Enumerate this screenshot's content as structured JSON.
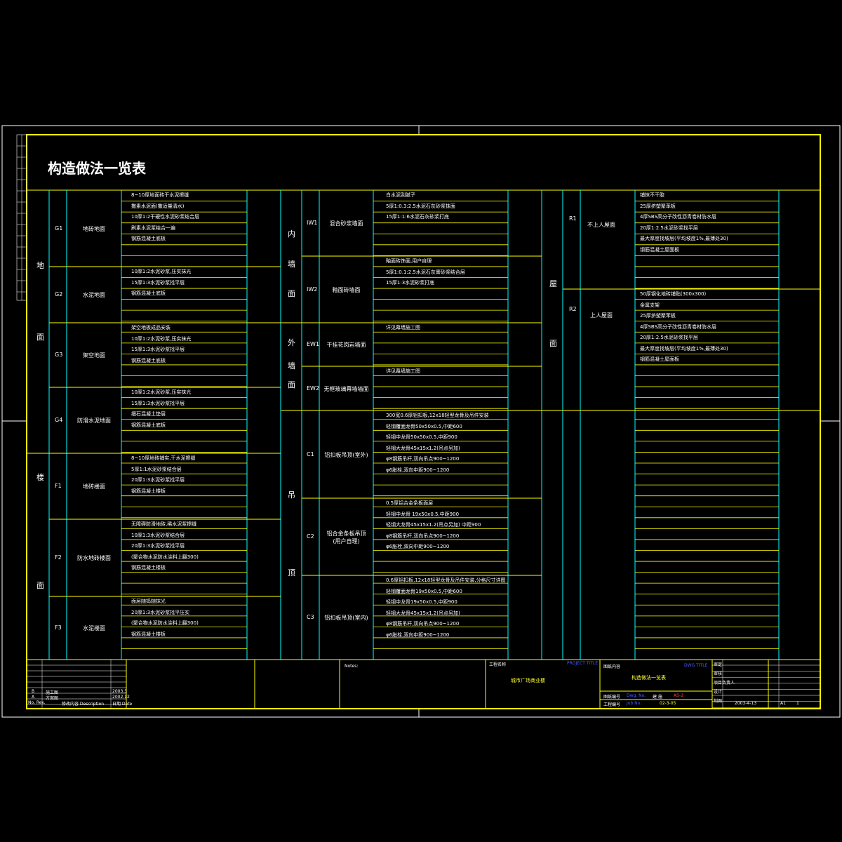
{
  "title": "构造做法一览表",
  "colors": {
    "frame": "#ffff00",
    "grid": "#00ffff",
    "row": "#ffff00",
    "text": "#ffffff",
    "blue": "#4a5cff"
  },
  "col1": {
    "cat_floor": [
      "地",
      "面"
    ],
    "cat_lou": [
      "楼",
      "面"
    ],
    "items": [
      {
        "code": "G1",
        "name": "地砖地面",
        "lines": [
          "8~10厚地面砖干水泥擦缝",
          "撒素水泥面(撒适量清水)",
          "10厚1:2干硬性水泥砂浆结合层",
          "刷素水泥浆结合一遍",
          "钢筋混凝土底板"
        ]
      },
      {
        "code": "G2",
        "name": "水泥地面",
        "lines": [
          "10厚1:2水泥砂浆,压实抹光",
          "15厚1:3水泥砂浆找平层",
          "钢筋混凝土底板"
        ]
      },
      {
        "code": "G3",
        "name": "架空地面",
        "lines": [
          "架空地板成品安装",
          "10厚1:2水泥砂浆,压实抹光",
          "15厚1:3水泥砂浆找平层",
          "钢筋混凝土底板"
        ]
      },
      {
        "code": "G4",
        "name": "防滑水泥地面",
        "lines": [
          "10厚1:2水泥砂浆,压实抹光",
          "15厚1:3水泥砂浆找平层",
          "细石混凝土垫层",
          "钢筋混凝土底板"
        ]
      },
      {
        "code": "F1",
        "name": "地砖楼面",
        "lines": [
          "8~10厚地砖铺实,干水泥擦缝",
          "5厚1:1水泥砂浆结合层",
          "20厚1:3水泥砂浆找平层",
          "钢筋混凝土楼板"
        ]
      },
      {
        "code": "F2",
        "name": "防水地砖楼面",
        "lines": [
          "无障碍防滑地砖,稀水泥浆擦缝",
          "10厚1:3水泥砂浆结合层",
          "20厚1:3水泥砂浆找平层",
          "(聚合物水泥防水涂料上翻300)",
          "钢筋混凝土楼板"
        ]
      },
      {
        "code": "F3",
        "name": "水泥楼面",
        "lines": [
          "面层随捣随抹光",
          "20厚1:3水泥砂浆找平压实",
          "(聚合物水泥防水涂料上翻300)",
          "钢筋混凝土楼板"
        ]
      }
    ]
  },
  "col2": {
    "cat_inner": [
      "内",
      "墙",
      "面"
    ],
    "cat_outer": [
      "外",
      "墙",
      "面"
    ],
    "cat_ceiling": [
      "吊",
      "顶"
    ],
    "items": [
      {
        "code": "IW1",
        "name": "混合砂浆墙面",
        "lines": [
          "白水泥刮腻子",
          "5厚1:0.3:2.5水泥石灰砂浆抹面",
          "15厚1:1:6水泥石灰砂浆打底"
        ]
      },
      {
        "code": "IW2",
        "name": "釉面砖墙面",
        "lines": [
          "釉面砖饰面,用户自理",
          "5厚1:0.1:2.5水泥石灰膏砂浆结合层",
          "15厚1:3水泥砂浆打底"
        ]
      },
      {
        "code": "EW1",
        "name": "干挂花岗岩墙面",
        "lines": [
          "详见幕墙施工图"
        ]
      },
      {
        "code": "EW2",
        "name": "无框玻璃幕墙墙面",
        "lines": [
          "详见幕墙施工图"
        ]
      },
      {
        "code": "C1",
        "name": "铝扣板吊顶(室外)",
        "lines": [
          "300宽0.6厚铝扣板,12x18轻型龙骨及吊件安装",
          "轻钢覆面龙骨50x50x0.5,中距600",
          "轻钢中龙骨50x50x0.5,中距900",
          "轻钢大龙骨45x15x1.2(吊点另加)",
          "φ8钢筋吊杆,双向吊点900~1200",
          "φ6胀栓,双向中距900~1200"
        ]
      },
      {
        "code": "C2",
        "name": "铝合金条板吊顶\n(用户自理)",
        "lines": [
          "0.5厚铝合金条板面层",
          "轻钢中龙骨  19x50x0.5,中距900",
          "轻钢大龙骨45x15x1.2(吊点另加) 中距900",
          "φ8钢筋吊杆,双向吊点900~1200",
          "φ6胀栓,双向中距900~1200"
        ]
      },
      {
        "code": "C3",
        "name": "铝扣板吊顶(室内)",
        "lines": [
          "0.6厚铝扣板,12x18轻型龙骨及吊件安装,分格尺寸详图",
          "轻钢覆面龙骨19x50x0.5,中距600",
          "轻钢中龙骨19x50x0.5,中距900",
          "轻钢大龙骨45x15x1.2(吊点另加)",
          "φ8钢筋吊杆,双向吊点900~1200",
          "φ6胀栓,双向中距900~1200"
        ]
      }
    ]
  },
  "col3": {
    "cat_roof": [
      "屋",
      "面"
    ],
    "items": [
      {
        "code": "R1",
        "name": "不上人屋面",
        "lines": [
          "铺抹不干胶",
          "25厚挤塑聚苯板",
          "4厚SBS高分子改性沥青卷材防水层",
          "20厚1:2.5水泥砂浆找平层",
          "最大厚度找坡层(平均坡度1%,最薄处30)",
          "钢筋混凝土屋面板"
        ]
      },
      {
        "code": "R2",
        "name": "上人屋面",
        "lines": [
          "50厚钢化地砖铺贴(300x300)",
          "金属支架",
          "25厚挤塑聚苯板",
          "4厚SBS高分子改性沥青卷材防水层",
          "20厚1:2.5水泥砂浆找平层",
          "最大厚度找坡层(平均坡度1%,最薄处30)",
          "钢筋混凝土屋面板"
        ]
      }
    ]
  },
  "titleblock": {
    "rev_rows": [
      {
        "no": "B",
        "desc": "施工图",
        "date": "2003.3"
      },
      {
        "no": "A",
        "desc": "方案图",
        "date": "2002.12"
      }
    ],
    "rev_header": {
      "no": "No. Rev.",
      "desc": "修改内容 Description",
      "date": "日期 Date"
    },
    "notes_label": "Notes:",
    "project_label": "工程名称",
    "project_label_en": "PROJECT TITLE",
    "project_name": "城市广场商业楼",
    "drawing_label": "图纸内容",
    "drawing_label_en": "DWG TITLE",
    "drawing_name": "构造做法一览表",
    "dwg_no_label": "图纸编号",
    "dwg_no_label_en": "Dwg. No.",
    "dwg_no_mid": "建 施",
    "dwg_no": "AS-2",
    "proj_no_label": "工程编号",
    "proj_no_label_en": "Job No.",
    "proj_no": "02-3-05",
    "date": "2003-4-13",
    "scale": "A1",
    "sheet": "1",
    "sign_labels": [
      "审定",
      "审核",
      "项目负责人",
      "设计",
      "制图"
    ]
  }
}
